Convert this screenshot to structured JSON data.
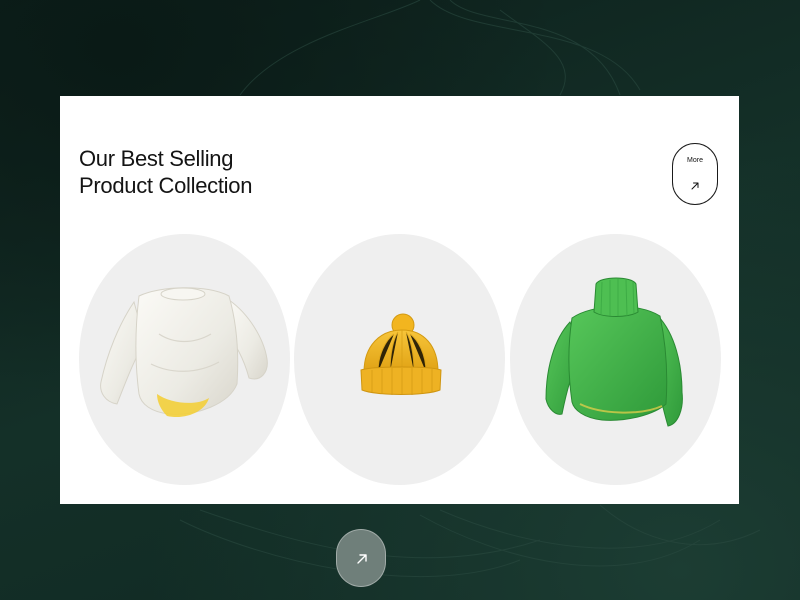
{
  "header": {
    "title_line1": "Our Best Selling",
    "title_line2": "Product Collection"
  },
  "more_button": {
    "label": "More",
    "icon": "arrow-up-right-icon"
  },
  "products": [
    {
      "name": "white-sweater",
      "icon": "white-sweater-image",
      "color": "#f4f2ec"
    },
    {
      "name": "yellow-beanie",
      "icon": "yellow-beanie-image",
      "color": "#f2b51f"
    },
    {
      "name": "green-turtleneck",
      "icon": "green-turtleneck-image",
      "color": "#3fb14a"
    }
  ],
  "cta_button": {
    "icon": "arrow-up-right-icon"
  },
  "colors": {
    "background": "#102822",
    "card": "#ffffff",
    "product_bg": "#efefef",
    "text": "#141414",
    "cta": "#6f7f7a"
  }
}
